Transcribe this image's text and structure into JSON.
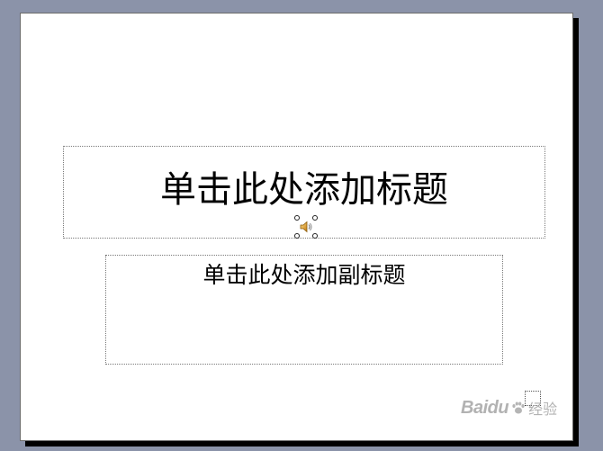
{
  "slide": {
    "title_placeholder": "单击此处添加标题",
    "subtitle_placeholder": "单击此处添加副标题"
  },
  "sound_object": {
    "icon": "speaker-icon",
    "selected": true
  },
  "watermark": {
    "brand": "Baidu",
    "sub": "经验",
    "icon": "paw-icon"
  },
  "colors": {
    "background": "#8b93a9",
    "slide": "#ffffff",
    "shadow": "#000000",
    "speaker": "#e0a030"
  }
}
